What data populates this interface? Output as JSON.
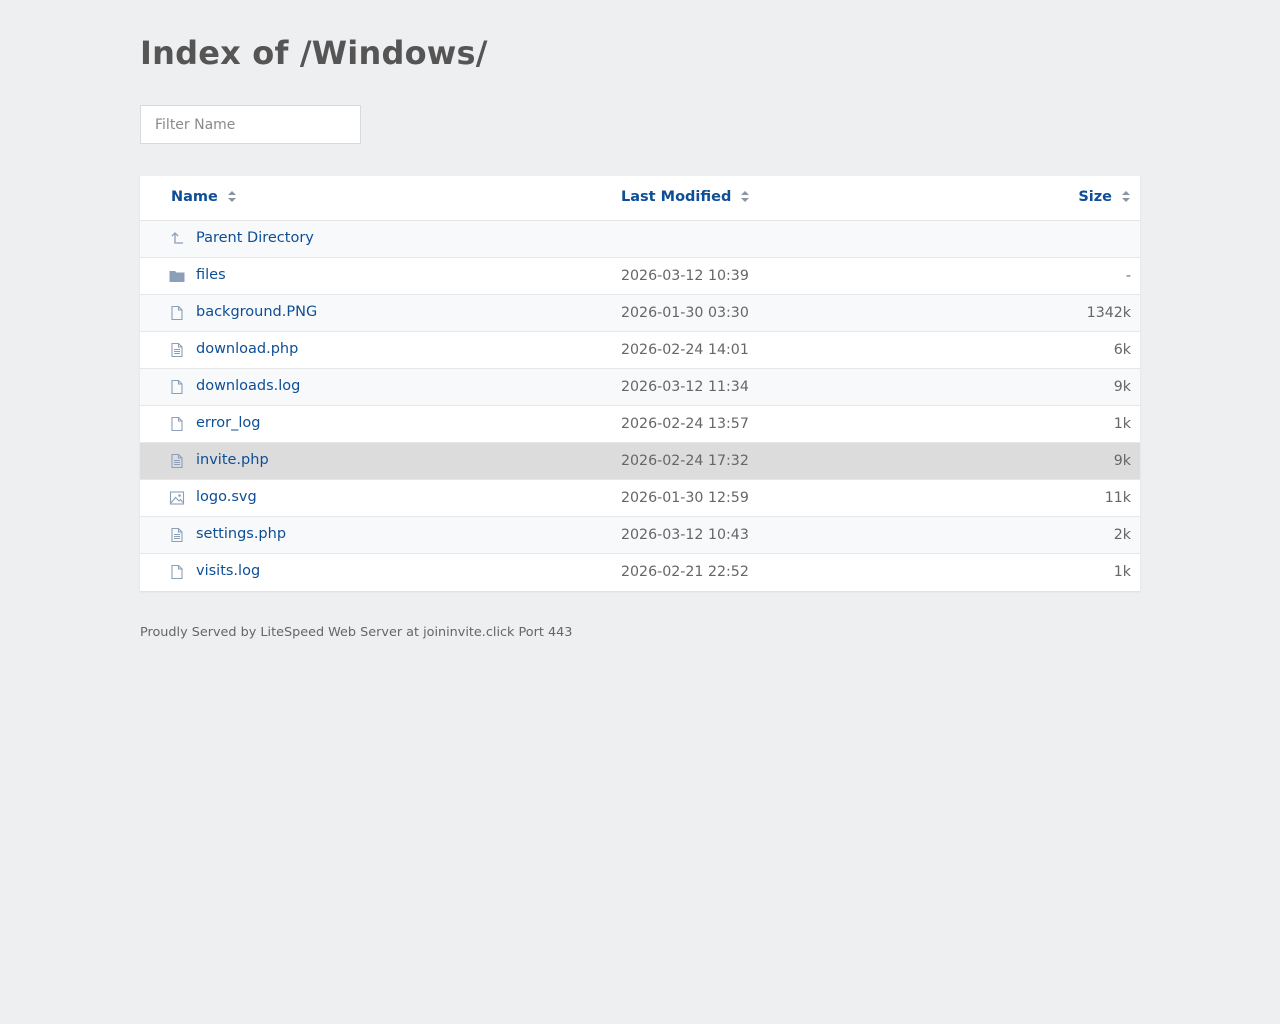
{
  "page": {
    "title": "Index of /Windows/",
    "filter_placeholder": "Filter Name",
    "footer": "Proudly Served by LiteSpeed Web Server at joininvite.click Port 443"
  },
  "columns": {
    "name": "Name",
    "last_modified": "Last Modified",
    "size": "Size"
  },
  "colors": {
    "link": "#0d4e96",
    "background": "#eeeff1",
    "icon": "#8c9fb8",
    "row_hover": "#dcdcdd"
  },
  "parent": {
    "label": "Parent Directory",
    "icon": "parent-directory-icon"
  },
  "entries": [
    {
      "name": "files",
      "modified": "2026-03-12 10:39",
      "size": "-",
      "icon": "folder-icon"
    },
    {
      "name": "background.PNG",
      "modified": "2026-01-30 03:30",
      "size": "1342k",
      "icon": "file-icon"
    },
    {
      "name": "download.php",
      "modified": "2026-02-24 14:01",
      "size": "6k",
      "icon": "text-file-icon"
    },
    {
      "name": "downloads.log",
      "modified": "2026-03-12 11:34",
      "size": "9k",
      "icon": "file-icon"
    },
    {
      "name": "error_log",
      "modified": "2026-02-24 13:57",
      "size": "1k",
      "icon": "file-icon"
    },
    {
      "name": "invite.php",
      "modified": "2026-02-24 17:32",
      "size": "9k",
      "icon": "text-file-icon",
      "hovered": true
    },
    {
      "name": "logo.svg",
      "modified": "2026-01-30 12:59",
      "size": "11k",
      "icon": "image-file-icon"
    },
    {
      "name": "settings.php",
      "modified": "2026-03-12 10:43",
      "size": "2k",
      "icon": "text-file-icon"
    },
    {
      "name": "visits.log",
      "modified": "2026-02-21 22:52",
      "size": "1k",
      "icon": "file-icon"
    }
  ]
}
